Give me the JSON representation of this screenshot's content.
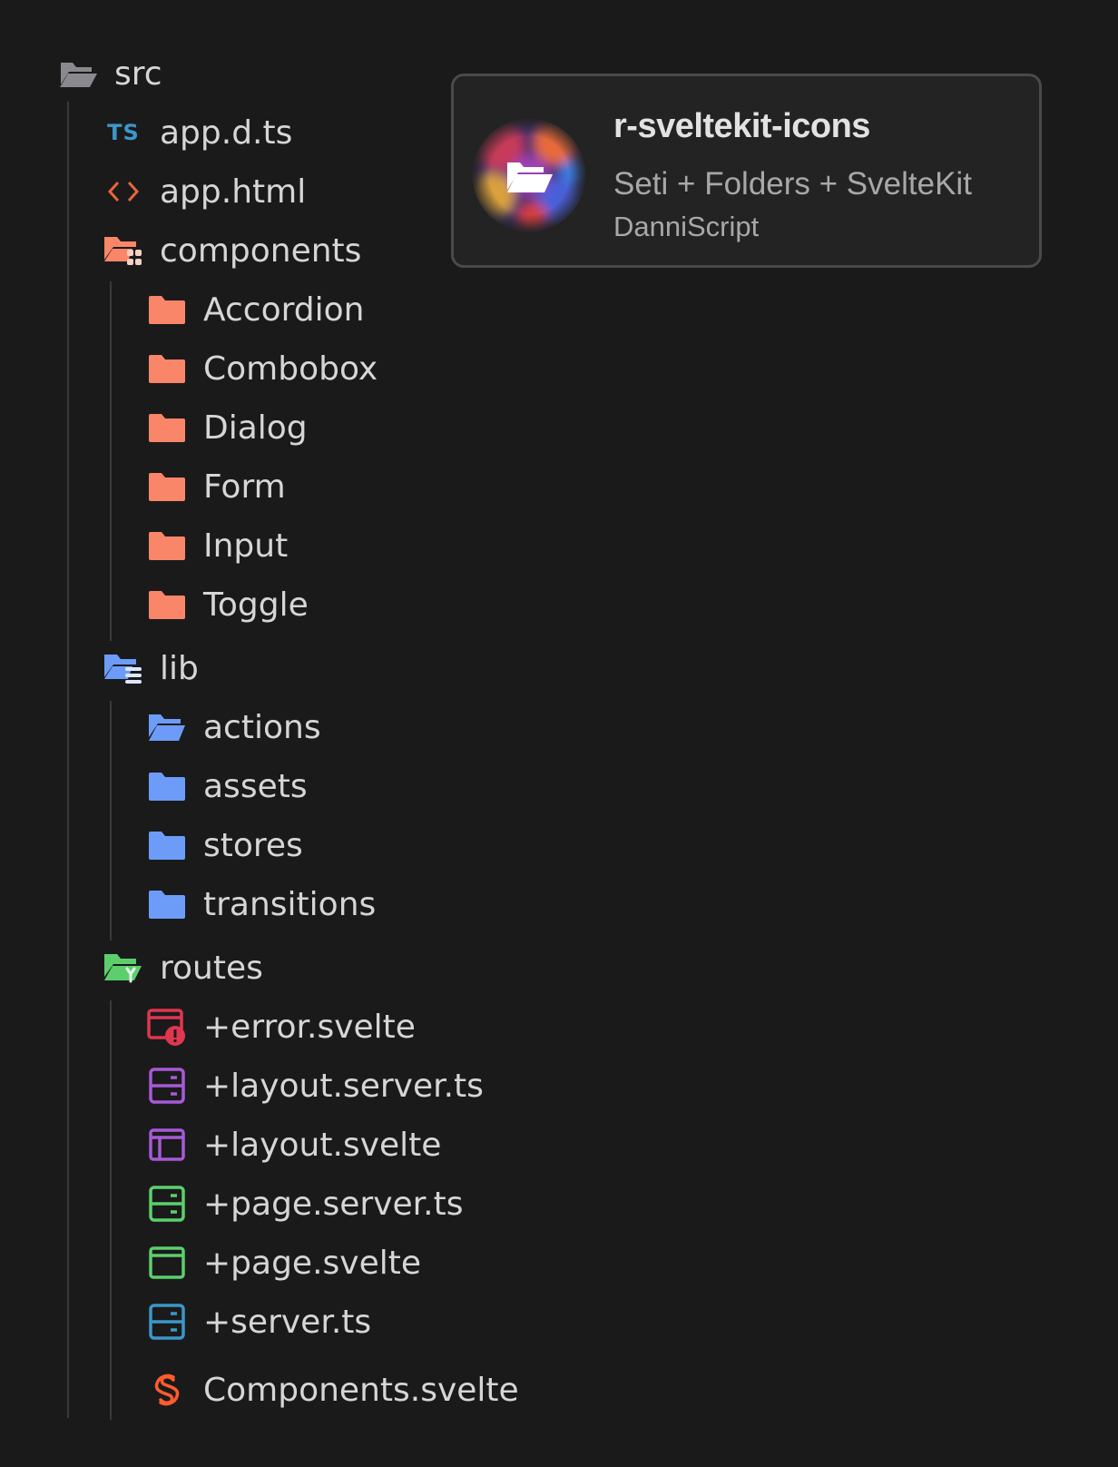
{
  "explorer": {
    "root": {
      "label": "src",
      "icon": "folder-open-icon"
    },
    "src_files": [
      {
        "label": "app.d.ts",
        "icon": "typescript-icon",
        "badge": "TS"
      },
      {
        "label": "app.html",
        "icon": "html-code-icon"
      }
    ],
    "components": {
      "label": "components",
      "icon": "components-folder-icon",
      "children": [
        "Accordion",
        "Combobox",
        "Dialog",
        "Form",
        "Input",
        "Toggle"
      ]
    },
    "lib": {
      "label": "lib",
      "icon": "lib-folder-icon",
      "children": [
        "actions",
        "assets",
        "stores",
        "transitions"
      ]
    },
    "routes": {
      "label": "routes",
      "icon": "routes-folder-icon",
      "children": [
        {
          "label": "+error.svelte",
          "icon": "error-page-icon"
        },
        {
          "label": "+layout.server.ts",
          "icon": "layout-server-icon"
        },
        {
          "label": "+layout.svelte",
          "icon": "layout-icon"
        },
        {
          "label": "+page.server.ts",
          "icon": "page-server-icon"
        },
        {
          "label": "+page.svelte",
          "icon": "page-icon"
        },
        {
          "label": "+server.ts",
          "icon": "server-icon"
        },
        {
          "label": "Components.svelte",
          "icon": "svelte-icon"
        }
      ]
    }
  },
  "extension_card": {
    "name": "r-sveltekit-icons",
    "description": "Seti + Folders + SvelteKit",
    "author": "DanniScript",
    "logo_icon": "folder-open-icon"
  },
  "colors": {
    "background": "#1a1a1b",
    "text": "#d6d6d6",
    "components_folder": "#f98668",
    "lib_folder": "#6d9cf8",
    "routes_folder": "#5ccf6c",
    "error": "#e0364f",
    "layout": "#a65ad6",
    "page": "#5ccf6c",
    "server": "#3b97c9",
    "svelte": "#ff5c2e"
  }
}
